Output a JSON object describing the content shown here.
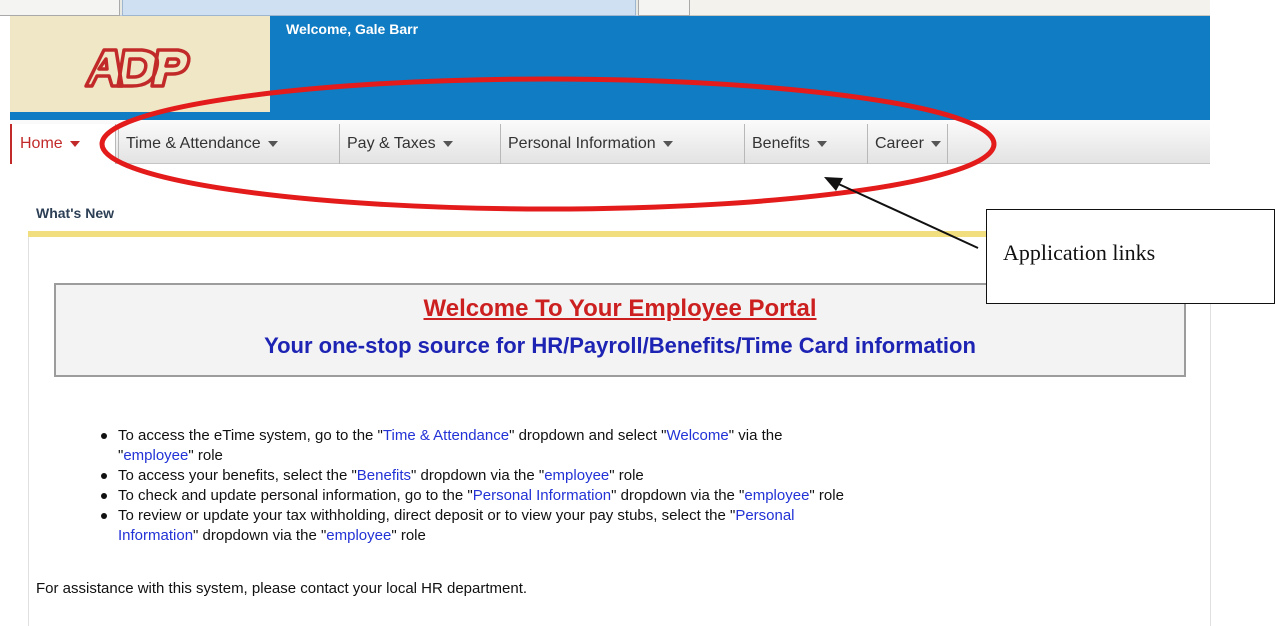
{
  "header": {
    "welcome_text": "Welcome, Gale Barr",
    "logo_text": "ADP",
    "brand_color": "#0f7cc3",
    "logo_color": "#c22a2a"
  },
  "nav": {
    "items": [
      {
        "label": "Home",
        "icon": "chevron-down-icon",
        "active": true
      },
      {
        "label": "Time & Attendance",
        "icon": "chevron-down-icon"
      },
      {
        "label": "Pay & Taxes",
        "icon": "chevron-down-icon"
      },
      {
        "label": "Personal Information",
        "icon": "chevron-down-icon"
      },
      {
        "label": "Benefits",
        "icon": "chevron-down-icon"
      },
      {
        "label": "Career",
        "icon": "chevron-down-icon"
      }
    ]
  },
  "main": {
    "section_title": "What's New",
    "portal_title": "Welcome To Your Employee Portal",
    "portal_subtitle": "Your one-stop source for HR/Payroll/Benefits/Time Card information",
    "bullets": [
      {
        "p1": "To access the eTime system, go to the \"",
        "l1": "Time & Attendance",
        "p2": "\" dropdown and select \"",
        "l2": "Welcome",
        "p3": "\" via the",
        "p4": "\"",
        "l3": "employee",
        "p5": "\" role"
      },
      {
        "p1": "To access your benefits, select the \"",
        "l1": "Benefits",
        "p2": "\" dropdown via the \"",
        "l2": "employee",
        "p3": "\" role"
      },
      {
        "p1": "To check and update personal information, go to the \"",
        "l1": "Personal Information",
        "p2": "\" dropdown via the \"",
        "l2": "employee",
        "p3": "\" role"
      },
      {
        "p1": "To review or update your tax withholding, direct deposit or to view your pay stubs, select the \"",
        "l1": "Personal",
        "p2": "Information",
        "p3": "\" dropdown via the \"",
        "l2": "employee",
        "p4": "\" role"
      }
    ],
    "assistance": "For assistance with this system, please contact your local HR department."
  },
  "annotation": {
    "callout_text": "Application links",
    "ellipse_color": "#e41b1b"
  }
}
